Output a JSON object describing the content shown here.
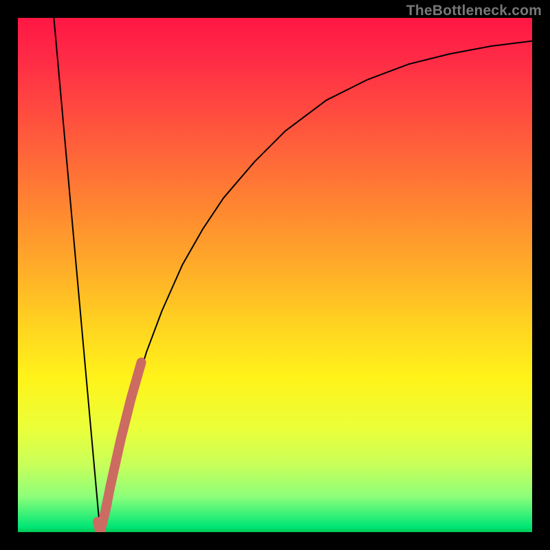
{
  "watermark": "TheBottleneck.com",
  "chart_data": {
    "type": "line",
    "title": "",
    "xlabel": "",
    "ylabel": "",
    "xlim": [
      0,
      100
    ],
    "ylim": [
      0,
      100
    ],
    "grid": false,
    "legend": false,
    "series": [
      {
        "name": "black-left-leg",
        "color": "#000000",
        "width": 2,
        "x": [
          7,
          16
        ],
        "values": [
          100,
          0
        ]
      },
      {
        "name": "black-right-curve",
        "color": "#000000",
        "width": 2,
        "x": [
          16,
          18,
          20,
          22,
          25,
          28,
          32,
          36,
          40,
          46,
          52,
          60,
          68,
          76,
          84,
          92,
          100
        ],
        "values": [
          0,
          8,
          17,
          25,
          35,
          43,
          52,
          59,
          65,
          72,
          78,
          84,
          88,
          91,
          93,
          94.5,
          95.5
        ]
      },
      {
        "name": "red-highlight",
        "color": "#cc6b62",
        "width": 14,
        "x": [
          15.5,
          16,
          17,
          18,
          20,
          22,
          24
        ],
        "values": [
          2,
          0,
          4,
          9,
          18,
          26,
          33
        ]
      }
    ]
  }
}
